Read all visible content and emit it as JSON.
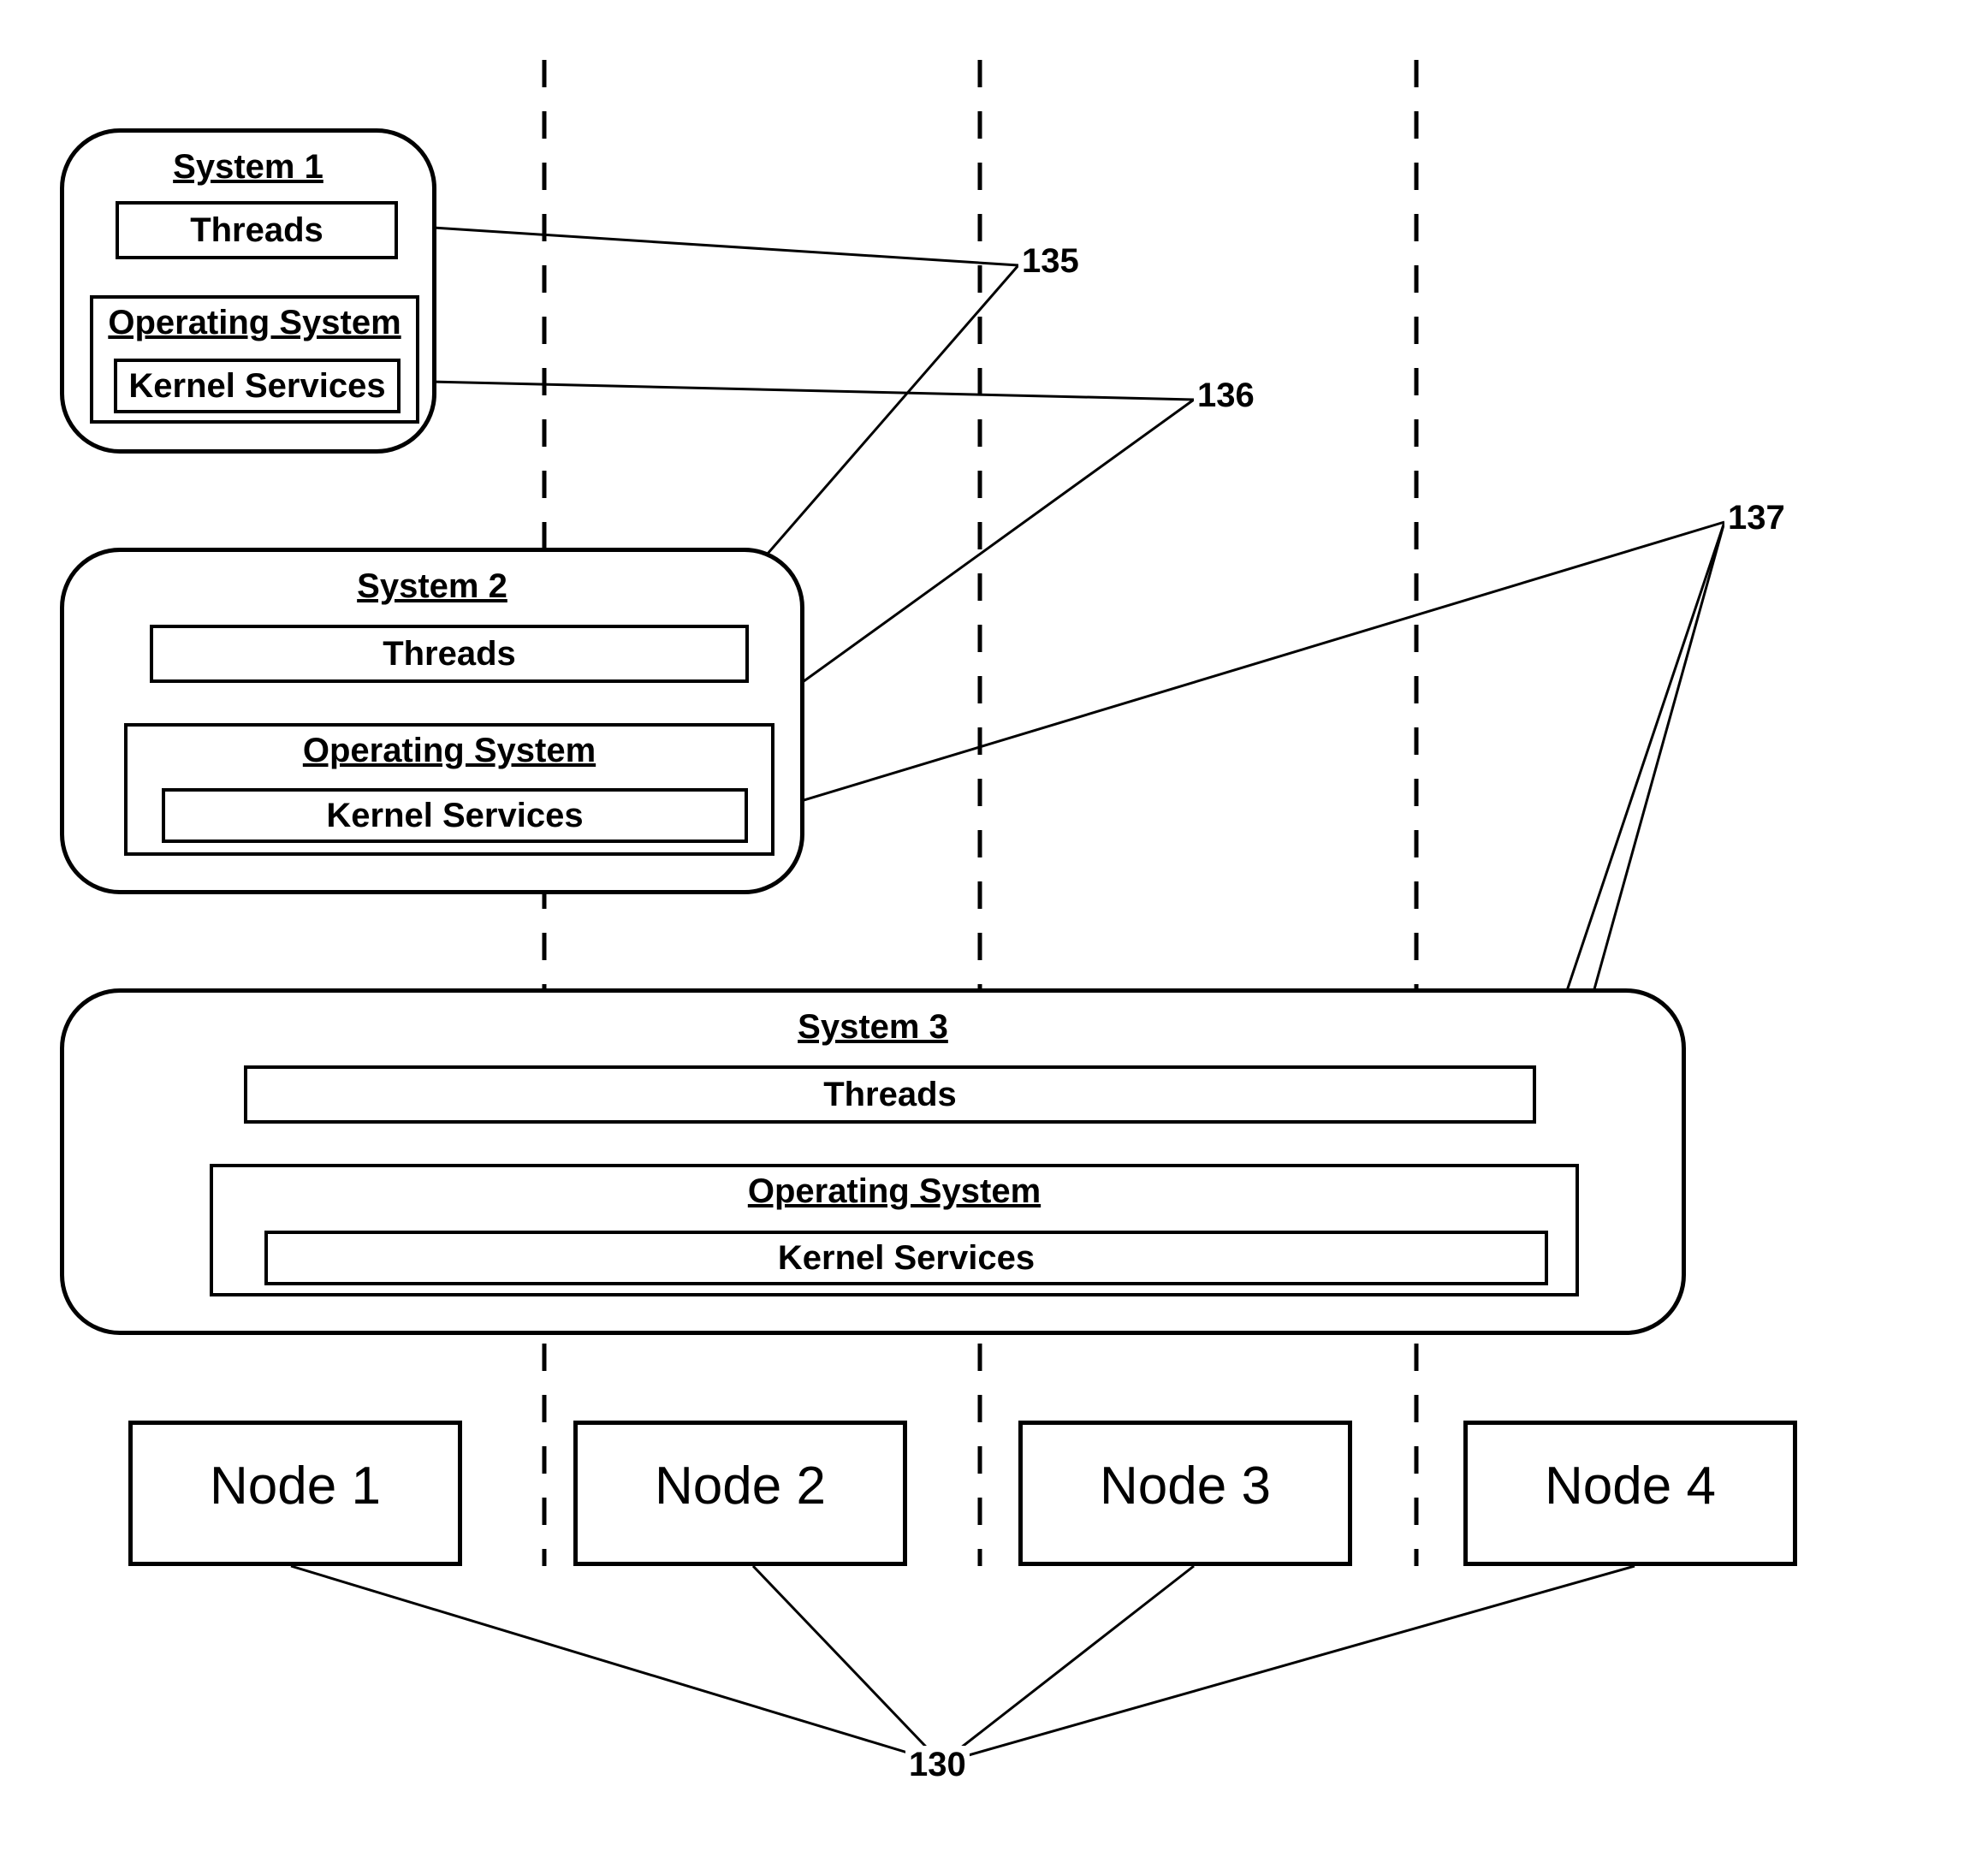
{
  "systems": [
    {
      "title": "System 1",
      "threads": "Threads",
      "os_title": "Operating System",
      "kernel": "Kernel Services"
    },
    {
      "title": "System 2",
      "threads": "Threads",
      "os_title": "Operating System",
      "kernel": "Kernel Services"
    },
    {
      "title": "System 3",
      "threads": "Threads",
      "os_title": "Operating System",
      "kernel": "Kernel Services"
    }
  ],
  "nodes": [
    "Node 1",
    "Node 2",
    "Node 3",
    "Node 4"
  ],
  "refs": {
    "r135": "135",
    "r136": "136",
    "r137": "137",
    "r130": "130"
  }
}
